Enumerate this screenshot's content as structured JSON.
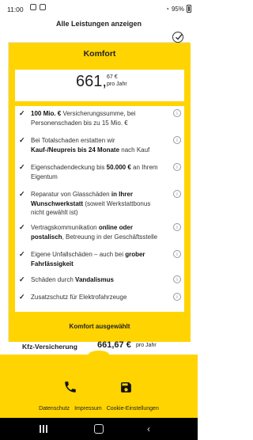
{
  "status": {
    "time": "11:00",
    "battery": "95%"
  },
  "header": {
    "show_all_label": "Alle Leistungen anzeigen"
  },
  "card": {
    "title": "Komfort",
    "price_main": "661,",
    "price_cents": "67 €",
    "price_unit": "pro Jahr",
    "features": [
      {
        "parts": [
          [
            "b",
            "100 Mio. €"
          ],
          [
            "t",
            " Versicherungssumme, bei Personenschaden bis zu 15 Mio. €"
          ]
        ]
      },
      {
        "parts": [
          [
            "t",
            "Bei Totalschaden erstatten wir "
          ],
          [
            "b",
            "Kauf-/Neupreis bis 24 Monate"
          ],
          [
            "t",
            " nach Kauf"
          ]
        ]
      },
      {
        "parts": [
          [
            "t",
            "Eigenschadendeckung bis "
          ],
          [
            "b",
            "50.000 €"
          ],
          [
            "t",
            " an Ihrem Eigentum"
          ]
        ]
      },
      {
        "parts": [
          [
            "t",
            "Reparatur von Glasschäden "
          ],
          [
            "b",
            "in Ihrer Wunschwerkstatt"
          ],
          [
            "t",
            " (soweit Werkstattbonus nicht gewählt ist)"
          ]
        ]
      },
      {
        "parts": [
          [
            "t",
            "Vertragskommunikation "
          ],
          [
            "b",
            "online oder postalisch"
          ],
          [
            "t",
            ", Betreuung in der Geschäftsstelle"
          ]
        ]
      },
      {
        "parts": [
          [
            "t",
            "Eigene Unfallschäden – auch bei "
          ],
          [
            "b",
            "grober Fahrlässigkeit"
          ]
        ]
      },
      {
        "parts": [
          [
            "t",
            "Schäden durch "
          ],
          [
            "b",
            "Vandalismus"
          ]
        ]
      },
      {
        "parts": [
          [
            "t",
            "Zusatzschutz für Elektrofahrzeuge"
          ]
        ]
      }
    ],
    "selected_label": "Komfort ausgewählt"
  },
  "footer_bar": {
    "title": "Kfz-Versicherung",
    "price": "661,67 €",
    "unit": "pro Jahr"
  },
  "links": {
    "privacy": "Datenschutz",
    "imprint": "Impressum",
    "cookies": "Cookie-Einstellungen"
  },
  "icons": {
    "phone": "phone-icon",
    "save": "save-icon",
    "info": "info-icon",
    "check": "check-icon"
  },
  "colors": {
    "accent": "#ffd400"
  }
}
